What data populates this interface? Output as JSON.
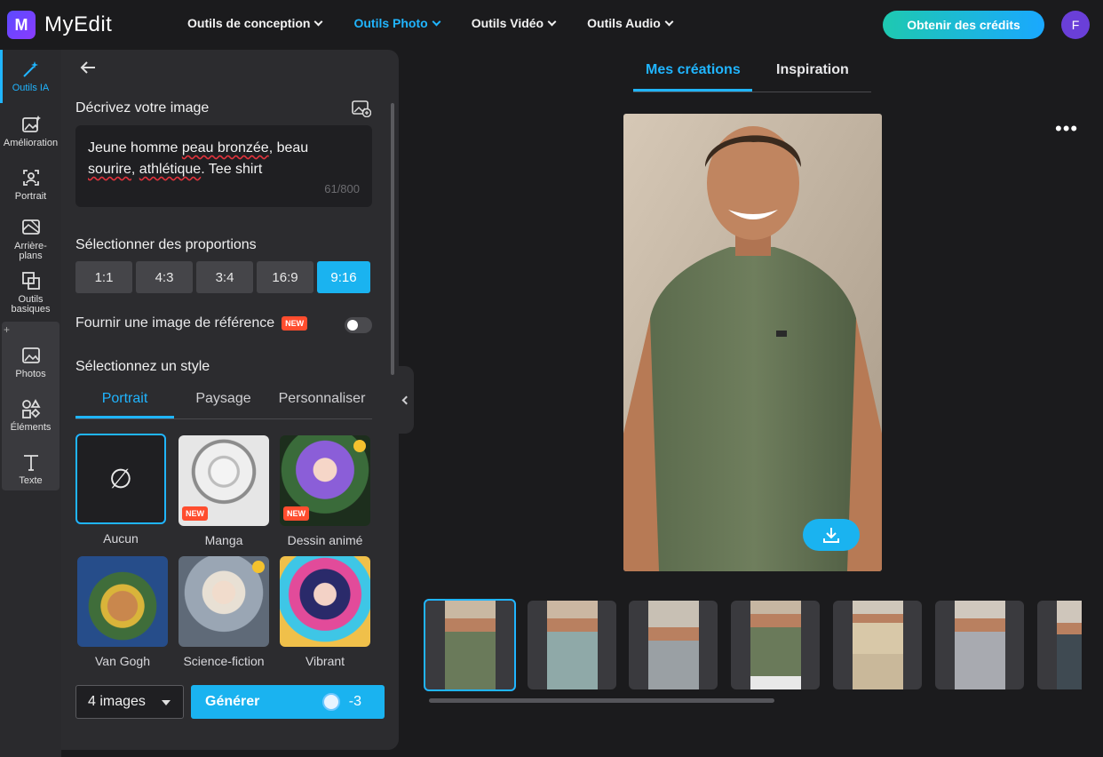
{
  "app": {
    "name": "MyEdit",
    "logo_letter": "M"
  },
  "nav": {
    "items": [
      {
        "label": "Outils de conception",
        "active": false
      },
      {
        "label": "Outils Photo",
        "active": true
      },
      {
        "label": "Outils Vidéo",
        "active": false
      },
      {
        "label": "Outils Audio",
        "active": false
      }
    ],
    "credits_button": "Obtenir des crédits",
    "avatar_initial": "F"
  },
  "rail": {
    "items": [
      {
        "label": "Outils IA",
        "icon": "magic-wand-icon",
        "active": true
      },
      {
        "label": "Amélioration",
        "icon": "enhance-image-icon"
      },
      {
        "label": "Portrait",
        "icon": "portrait-icon"
      },
      {
        "label": "Arrière-plans",
        "icon": "background-icon"
      },
      {
        "label": "Outils basiques",
        "icon": "crop-icon"
      },
      {
        "label": "Photos",
        "icon": "image-icon"
      },
      {
        "label": "Éléments",
        "icon": "shapes-icon"
      },
      {
        "label": "Texte",
        "icon": "text-icon"
      }
    ],
    "plus": "+"
  },
  "panel": {
    "describe_title": "Décrivez votre image",
    "prompt_text": "Jeune homme peau bronzée, beau sourire, athlétique. Tee shirt",
    "prompt_part_1": "Jeune homme ",
    "prompt_spell_1": "peau bronzée",
    "prompt_part_2": ", beau",
    "prompt_spell_2": "sourire",
    "prompt_part_3": ", ",
    "prompt_spell_3": "athlétique",
    "prompt_part_4": ". Tee shirt",
    "counter": "61/800",
    "ratio_title": "Sélectionner des proportions",
    "ratios": [
      "1:1",
      "4:3",
      "3:4",
      "16:9",
      "9:16"
    ],
    "ratio_selected": "9:16",
    "reference_label": "Fournir une image de référence",
    "new_badge": "NEW",
    "reference_enabled": false,
    "style_title": "Sélectionnez un style",
    "style_tabs": [
      "Portrait",
      "Paysage",
      "Personnaliser"
    ],
    "style_tab_active": "Portrait",
    "styles": [
      {
        "label": "Aucun",
        "selected": true,
        "glyph": "∅"
      },
      {
        "label": "Manga",
        "badge": "NEW"
      },
      {
        "label": "Dessin animé",
        "badge": "NEW",
        "premium": true
      },
      {
        "label": "Van Gogh"
      },
      {
        "label": "Science-fiction",
        "premium": true
      },
      {
        "label": "Vibrant"
      }
    ],
    "image_count": "4 images",
    "generate_label": "Générer",
    "generate_cost": "-3"
  },
  "main": {
    "tabs": [
      "Mes créations",
      "Inspiration"
    ],
    "tab_active": "Mes créations",
    "more": "•••",
    "thumbnail_count": 7,
    "selected_thumbnail": 0
  },
  "colors": {
    "accent": "#20b5ff",
    "new_badge": "#ff4d2e",
    "panel": "#2c2c2f"
  }
}
